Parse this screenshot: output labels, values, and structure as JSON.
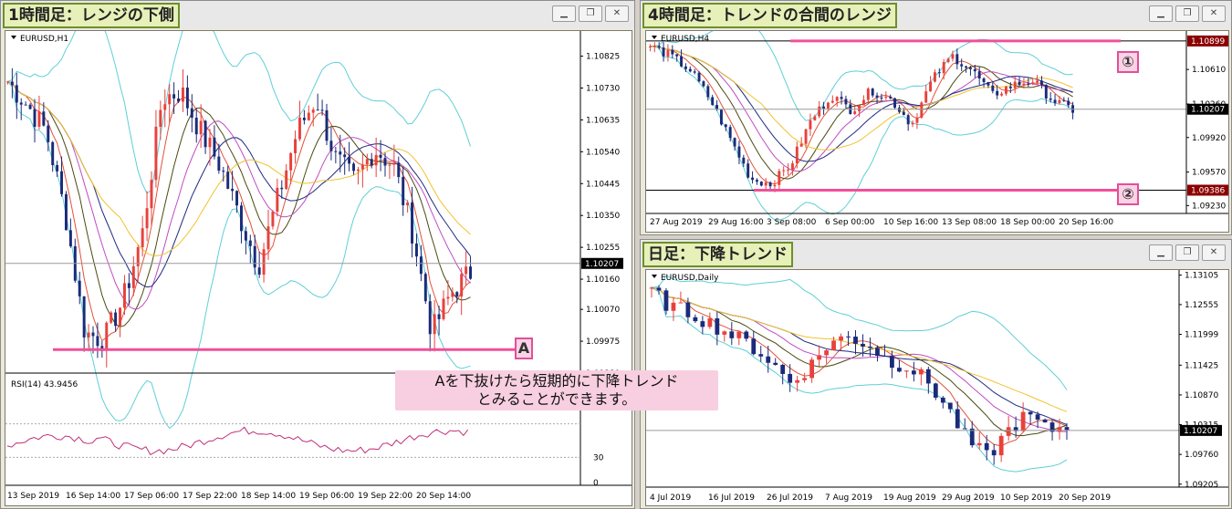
{
  "windows": {
    "h1": {
      "title": "1時間足：レンジの下側",
      "symbol": "EURUSD,H1",
      "price_ticks": [
        "1.10825",
        "1.10730",
        "1.10635",
        "1.10540",
        "1.10445",
        "1.10350",
        "1.10255",
        "1.10160",
        "1.10070",
        "1.09975",
        "1.09880"
      ],
      "current_price": "1.10207",
      "time_ticks": [
        "13 Sep 2019",
        "16 Sep 14:00",
        "17 Sep 06:00",
        "17 Sep 22:00",
        "18 Sep 14:00",
        "19 Sep 06:00",
        "19 Sep 22:00",
        "20 Sep 14:00"
      ],
      "rsi_label": "RSI(14) 43.9456",
      "rsi_ticks": [
        "30",
        "0"
      ],
      "marker": "A"
    },
    "h4": {
      "title": "4時間足：トレンドの合間のレンジ",
      "symbol": "EURUSD,H4",
      "price_ticks": [
        "1.10610",
        "1.10260",
        "1.09920",
        "1.09570",
        "1.09230"
      ],
      "level1_price": "1.10899",
      "level2_price": "1.09386",
      "current_price": "1.10207",
      "time_ticks": [
        "27 Aug 2019",
        "29 Aug 16:00",
        "3 Sep 08:00",
        "6 Sep 00:00",
        "10 Sep 16:00",
        "13 Sep 08:00",
        "18 Sep 00:00",
        "20 Sep 16:00"
      ],
      "marker1": "①",
      "marker2": "②"
    },
    "daily": {
      "title": "日足：下降トレンド",
      "symbol": "EURUSD,Daily",
      "price_ticks": [
        "1.13105",
        "1.12555",
        "1.11999",
        "1.11425",
        "1.10870",
        "1.10315",
        "1.09760",
        "1.09205"
      ],
      "current_price": "1.10207",
      "time_ticks": [
        "4 Jul 2019",
        "16 Jul 2019",
        "26 Jul 2019",
        "7 Aug 2019",
        "19 Aug 2019",
        "29 Aug 2019",
        "10 Sep 2019",
        "20 Sep 2019"
      ]
    }
  },
  "callout": {
    "line1": "Aを下抜けたら短期的に下降トレンド",
    "line2": "とみることができます。"
  },
  "colors": {
    "bull": "#e8413c",
    "bear": "#1a2b7a",
    "bollinger": "#5fcfd6",
    "level": "#f0509a",
    "ma_gold": "#f2c22e",
    "ma_navy": "#1f2a80",
    "ma_purple": "#c04cc0",
    "ma_olive": "#4a4a10",
    "ma_red": "#e0533a",
    "rsi": "#c0307a"
  },
  "chart_data": [
    {
      "type": "candlestick",
      "title": "EURUSD,H1",
      "ylim": [
        1.0988,
        1.109
      ],
      "horizontal_levels": [
        {
          "name": "A",
          "value": 1.0995
        }
      ],
      "current": 1.10207,
      "rsi": {
        "label": "RSI(14)",
        "value": 43.9456,
        "levels": [
          30
        ]
      }
    },
    {
      "type": "candlestick",
      "title": "EURUSD,H4",
      "ylim": [
        1.0915,
        1.11
      ],
      "horizontal_levels": [
        {
          "name": "①",
          "value": 1.10899
        },
        {
          "name": "②",
          "value": 1.09386
        }
      ],
      "current": 1.10207
    },
    {
      "type": "candlestick",
      "title": "EURUSD,Daily",
      "ylim": [
        1.0915,
        1.132
      ],
      "current": 1.10207
    }
  ]
}
